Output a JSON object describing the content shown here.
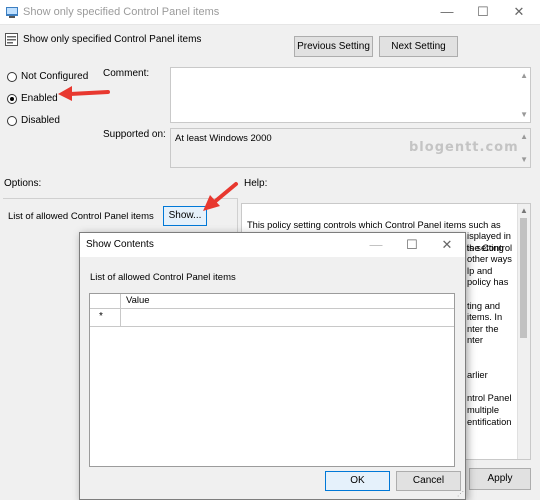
{
  "window": {
    "title": "Show only specified Control Panel items",
    "minimize_glyph": "—",
    "maximize_glyph": "☐",
    "close_glyph": "✕"
  },
  "header": {
    "policy_title": "Show only specified Control Panel items",
    "previous_label": "Previous Setting",
    "next_label": "Next Setting"
  },
  "state": {
    "options": [
      {
        "label": "Not Configured",
        "selected": false
      },
      {
        "label": "Enabled",
        "selected": true
      },
      {
        "label": "Disabled",
        "selected": false
      }
    ]
  },
  "comment": {
    "label": "Comment:",
    "value": ""
  },
  "supported": {
    "label": "Supported on:",
    "value": "At least Windows 2000"
  },
  "watermark": "blogentt.com",
  "options_label": "Options:",
  "help_label": "Help:",
  "list_label": "List of allowed Control Panel items",
  "show_button": "Show...",
  "help_text": "This policy setting controls which Control Panel items such as\nMouse, System, or Personalization, are displayed on the Control\nPanel window and the Start screen. ... displayed in\n... this setting\n... other ways\n... lp and\n... policy has\n\n... ting and\n... items. In\n... nter the\n... nter\n\n\n... arlier\n\n... ntrol Panel\n... multiple\n... entification",
  "help_visible_fragments": [
    "This policy setting controls which Control Panel items such as",
    "Mouse, System, or Personalization, are displayed on the Control",
    "isplayed in",
    "is setting",
    "other ways",
    "lp and",
    "policy has",
    "ting and",
    "items. In",
    "nter the",
    "nter",
    "arlier",
    "ntrol Panel",
    "multiple",
    "entification"
  ],
  "footer": {
    "apply_label": "Apply"
  },
  "dialog": {
    "title": "Show Contents",
    "subtitle": "List of allowed Control Panel items",
    "column_header": "Value",
    "row_marker": "*",
    "ok_label": "OK",
    "cancel_label": "Cancel",
    "minimize_glyph": "—",
    "maximize_glyph": "☐",
    "close_glyph": "✕"
  },
  "colors": {
    "accent": "#0078d7",
    "annotation_arrow": "#e8382f"
  }
}
